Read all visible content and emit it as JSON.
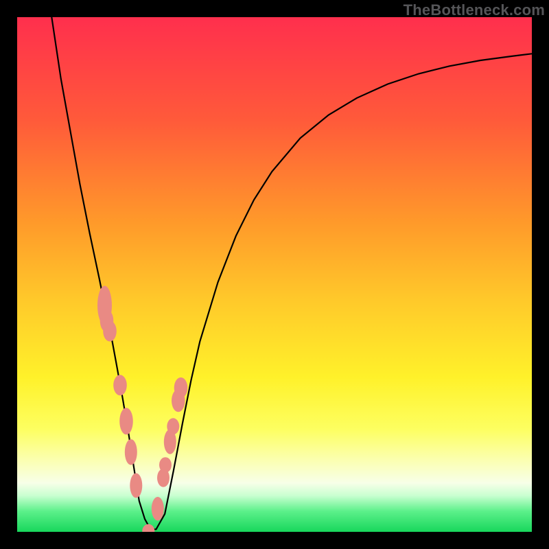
{
  "watermark": "TheBottleneck.com",
  "chart_data": {
    "type": "line",
    "title": "",
    "xlabel": "",
    "ylabel": "",
    "xlim": [
      0,
      100
    ],
    "ylim": [
      0,
      100
    ],
    "gradient_stops": [
      {
        "pos": 0.0,
        "color": "#ff2f4d"
      },
      {
        "pos": 0.2,
        "color": "#ff5a3a"
      },
      {
        "pos": 0.4,
        "color": "#ff9a2a"
      },
      {
        "pos": 0.55,
        "color": "#ffc92a"
      },
      {
        "pos": 0.7,
        "color": "#fff12a"
      },
      {
        "pos": 0.8,
        "color": "#fdff60"
      },
      {
        "pos": 0.86,
        "color": "#fbffb0"
      },
      {
        "pos": 0.905,
        "color": "#f7ffe8"
      },
      {
        "pos": 0.93,
        "color": "#c8ffd0"
      },
      {
        "pos": 0.96,
        "color": "#5cf08a"
      },
      {
        "pos": 1.0,
        "color": "#18d75c"
      }
    ],
    "series": [
      {
        "name": "bottleneck-curve",
        "x": [
          6.7,
          8.5,
          10.4,
          12.2,
          14.1,
          16.0,
          17.0,
          18.2,
          19.3,
          20.4,
          21.5,
          22.6,
          23.7,
          24.8,
          25.9,
          27.0,
          28.7,
          30.4,
          32.1,
          33.8,
          35.5,
          39.0,
          42.5,
          46.0,
          49.5,
          55.0,
          60.5,
          66.0,
          72.0,
          78.0,
          84.0,
          90.0,
          96.0,
          100.0
        ],
        "y": [
          100.0,
          88.0,
          77.5,
          67.5,
          58.0,
          49.0,
          44.0,
          38.5,
          32.5,
          26.5,
          20.0,
          13.0,
          6.0,
          2.5,
          0.5,
          0.5,
          3.5,
          12.0,
          21.0,
          29.5,
          37.0,
          48.5,
          57.5,
          64.5,
          70.0,
          76.5,
          81.0,
          84.3,
          87.0,
          89.0,
          90.5,
          91.6,
          92.4,
          92.9
        ]
      }
    ],
    "markers": {
      "name": "highlighted-points",
      "color": "#e98a84",
      "x": [
        17.0,
        17.4,
        18.0,
        20.0,
        21.2,
        22.1,
        23.1,
        25.5,
        27.3,
        28.4,
        28.8,
        29.7,
        30.3,
        31.3,
        31.8
      ],
      "y": [
        44.0,
        41.0,
        39.0,
        28.5,
        21.5,
        15.5,
        9.0,
        0.2,
        4.5,
        10.5,
        13.0,
        17.5,
        20.5,
        25.5,
        28.0
      ],
      "rx": [
        1.4,
        1.3,
        1.3,
        1.3,
        1.3,
        1.2,
        1.2,
        1.2,
        1.2,
        1.2,
        1.2,
        1.2,
        1.2,
        1.3,
        1.3
      ],
      "ry": [
        3.8,
        2.2,
        2.0,
        2.0,
        2.6,
        2.5,
        2.4,
        1.3,
        2.3,
        1.8,
        1.5,
        2.4,
        1.6,
        2.2,
        2.0
      ]
    }
  }
}
